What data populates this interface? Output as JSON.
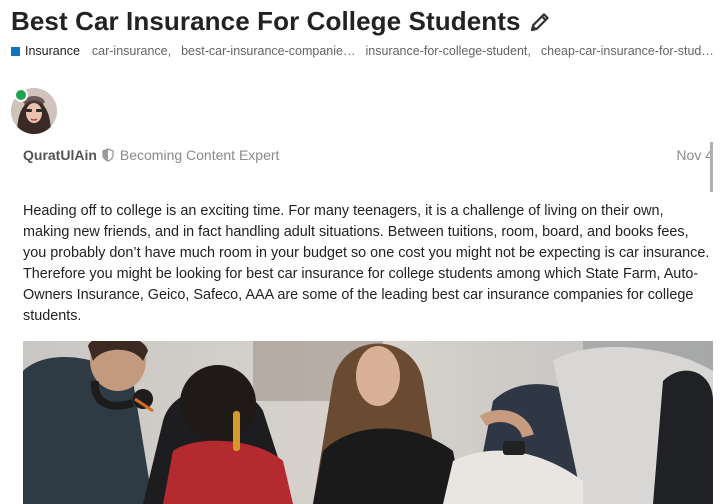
{
  "topic": {
    "title": "Best Car Insurance For College Students",
    "category": {
      "name": "Insurance",
      "color": "#0e76bd"
    },
    "tags": [
      "car-insurance,",
      "best-car-insurance-companie…",
      "insurance-for-college-student,",
      "cheap-car-insurance-for-stud…"
    ]
  },
  "post": {
    "author": "QuratUlAin",
    "author_title": "Becoming Content Expert",
    "date": "Nov 4",
    "online_status_color": "#1ca551",
    "body": "Heading off to college is an exciting time. For many teenagers, it is a challenge of living on their own, making new friends, and in fact handling adult situations. Between tuitions, room, board, and books fees, you probably don’t have much room in your budget so one cost you might not be expecting is car insurance. Therefore you might be looking for best car insurance for college students among which State Farm, Auto-Owners Insurance, Geico, Safeco, AAA are some of the leading best car insurance companies for college students."
  },
  "icons": {
    "edit": "pencil-icon",
    "trust_level": "shield-icon"
  }
}
